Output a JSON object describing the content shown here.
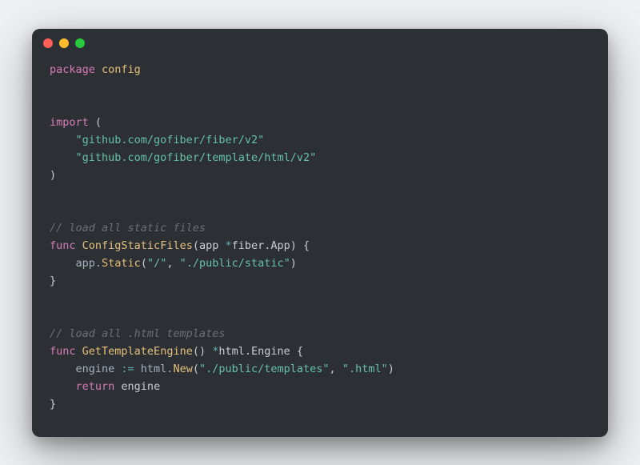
{
  "titlebar": {
    "close": "",
    "minimize": "",
    "zoom": ""
  },
  "tokens": {
    "kw_package": "package",
    "pkg_name": "config",
    "kw_import": "import",
    "paren_open": "(",
    "import1": "\"github.com/gofiber/fiber/v2\"",
    "import2": "\"github.com/gofiber/template/html/v2\"",
    "paren_close": ")",
    "comment1": "// load all static files",
    "kw_func1": "func",
    "fn1_name": "ConfigStaticFiles",
    "fn1_sig_open": "(app ",
    "op_star1": "*",
    "fn1_type": "fiber.App",
    "fn1_sig_close": ") {",
    "fn1_body_lead": "    app.",
    "fn1_call": "Static",
    "fn1_args_open": "(",
    "fn1_arg1": "\"/\"",
    "fn1_args_sep": ", ",
    "fn1_arg2": "\"./public/static\"",
    "fn1_args_close": ")",
    "brace_close1": "}",
    "comment2": "// load all .html templates",
    "kw_func2": "func",
    "fn2_name": "GetTemplateEngine",
    "fn2_sig_open": "() ",
    "op_star2": "*",
    "fn2_type": "html.Engine",
    "fn2_sig_close": " {",
    "fn2_body_lead": "    engine ",
    "op_assign": ":=",
    "fn2_body_call_lead": " html.",
    "fn2_call": "New",
    "fn2_args_open": "(",
    "fn2_arg1": "\"./public/templates\"",
    "fn2_args_sep": ", ",
    "fn2_arg2": "\".html\"",
    "fn2_args_close": ")",
    "kw_return": "return",
    "fn2_ret_lead": "    ",
    "fn2_ret_val": " engine",
    "brace_close2": "}"
  }
}
